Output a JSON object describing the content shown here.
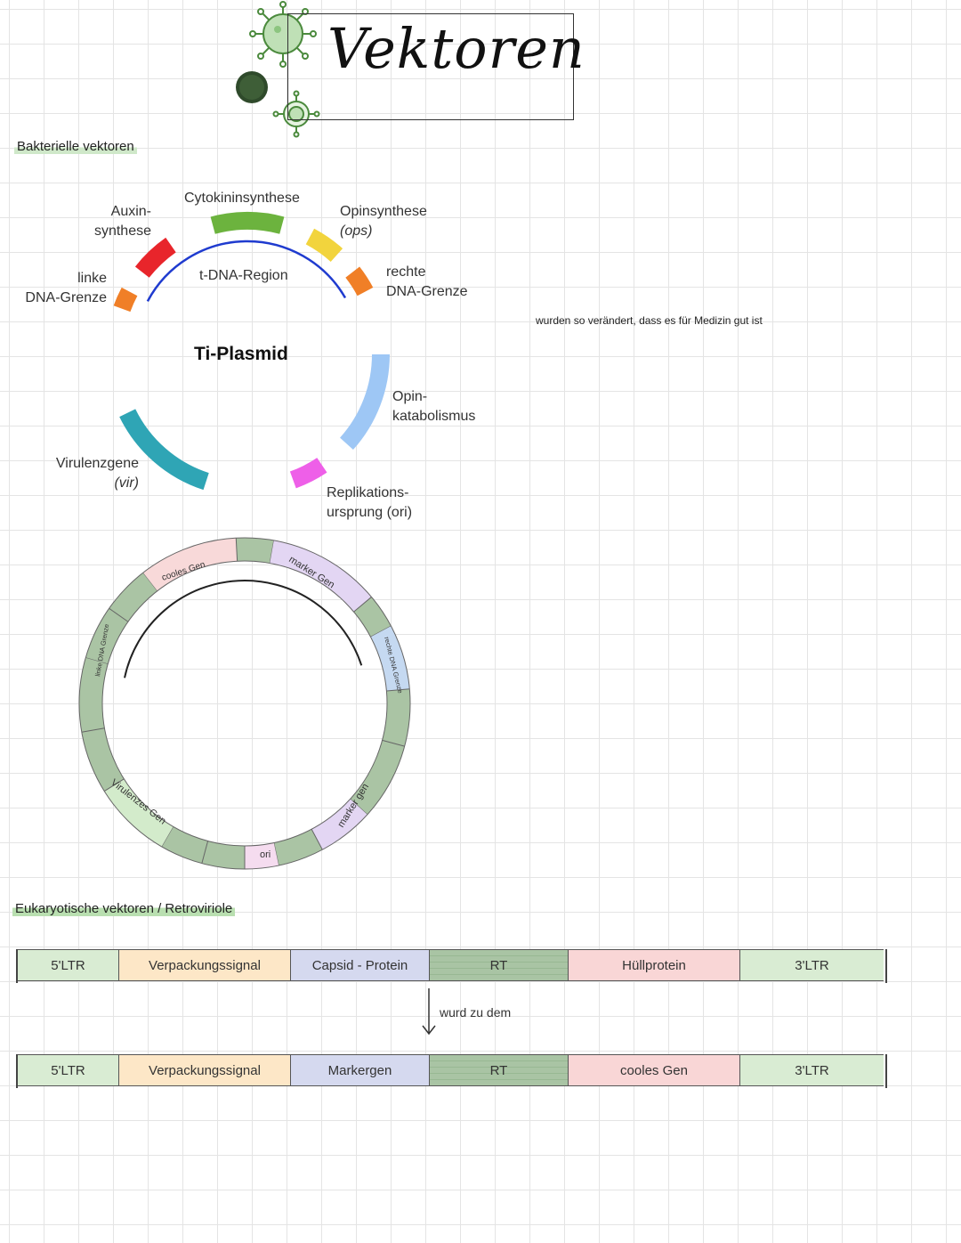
{
  "header": {
    "title": "Vektoren"
  },
  "sections": {
    "bacterial": "Bakterielle vektoren",
    "eukaryotic": "Eukaryotische vektoren / Retroviriole"
  },
  "side_note": "wurden so verändert, dass es für Medizin gut ist",
  "ti_plasmid": {
    "name": "Ti-Plasmid",
    "region": "t-DNA-Region",
    "labels": {
      "auxin_1": "Auxin-",
      "auxin_2": "synthese",
      "cytokinin": "Cytokininsynthese",
      "opin_syn": "Opinsynthese",
      "opin_syn_abbr": "(ops)",
      "left_1": "linke",
      "left_2": "DNA-Grenze",
      "right_1": "rechte",
      "right_2": "DNA-Grenze",
      "opin_kat_1": "Opin-",
      "opin_kat_2": "katabolismus",
      "vir_1": "Virulenzgene",
      "vir_abbr": "(vir)",
      "ori_1": "Replikations-",
      "ori_2": "ursprung (ori)"
    },
    "colors": {
      "backbone": "#4f63e6",
      "auxin": "#e8252b",
      "cytokinin": "#6cb33e",
      "opin_syn": "#f2d43d",
      "border": "#f07f27",
      "opin_kat": "#9ec7f5",
      "vir": "#2fa5b5",
      "ori": "#ee5fe8"
    }
  },
  "modified_plasmid": {
    "labels": {
      "cool_gene": "cooles Gen",
      "marker_1": "marker Gen",
      "right_border": "rechte DNA Grenze",
      "left_border": "linke DNA Grenze",
      "marker_2": "marker gen",
      "ori": "ori",
      "vir": "Virulenzes Gen"
    },
    "colors": {
      "backbone": "#aac4a4",
      "cool": "#f8d9d9",
      "marker": "#e3d6f3",
      "right": "#c5d9f1",
      "ori": "#f5dcef",
      "vir": "#d3ebcb"
    }
  },
  "retrovirus": {
    "arrow_label": "wurd zu dem",
    "original": [
      {
        "label": "5'LTR",
        "color": "#d9ecd3"
      },
      {
        "label": "Verpackungssignal",
        "color": "#fde7c7"
      },
      {
        "label": "Capsid - Protein",
        "color": "#d5d9ef"
      },
      {
        "label": "RT",
        "color": "#a9c4a4"
      },
      {
        "label": "Hüllprotein",
        "color": "#f9d6d6"
      },
      {
        "label": "3'LTR",
        "color": "#d9ecd3"
      }
    ],
    "modified": [
      {
        "label": "5'LTR",
        "color": "#d9ecd3"
      },
      {
        "label": "Verpackungssignal",
        "color": "#fde7c7"
      },
      {
        "label": "Markergen",
        "color": "#d5d9ef"
      },
      {
        "label": "RT",
        "color": "#a9c4a4"
      },
      {
        "label": "cooles Gen",
        "color": "#f9d6d6"
      },
      {
        "label": "3'LTR",
        "color": "#d9ecd3"
      }
    ]
  }
}
